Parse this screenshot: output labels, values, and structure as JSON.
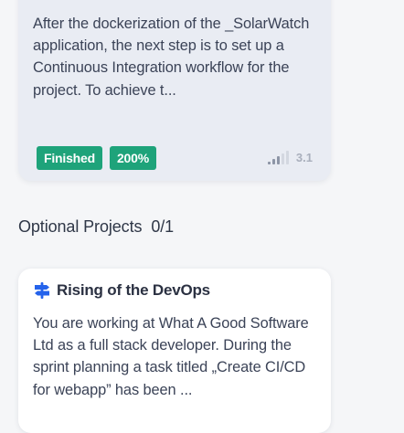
{
  "completed_project": {
    "description": "After the dockerization of the _SolarWatch application, the next step is to set up a Continuous Integration workflow for the project. To achieve t...",
    "status_badge": "Finished",
    "score_badge": "200%",
    "difficulty": {
      "level": 3,
      "max_level": 5,
      "rating": "3.1",
      "icon": "signal-bars-icon"
    }
  },
  "optional_section": {
    "title": "Optional Projects",
    "count": "0/1"
  },
  "optional_project": {
    "icon": "signpost-icon",
    "title": "Rising of the DevOps",
    "description": "You are working at What A Good Software Ltd as a full stack developer. During the sprint planning a task titled „Create CI/CD for webapp” has been ..."
  },
  "colors": {
    "accent_green": "#1ea37a",
    "accent_blue": "#2563eb",
    "card_background": "#e9ecf3"
  }
}
